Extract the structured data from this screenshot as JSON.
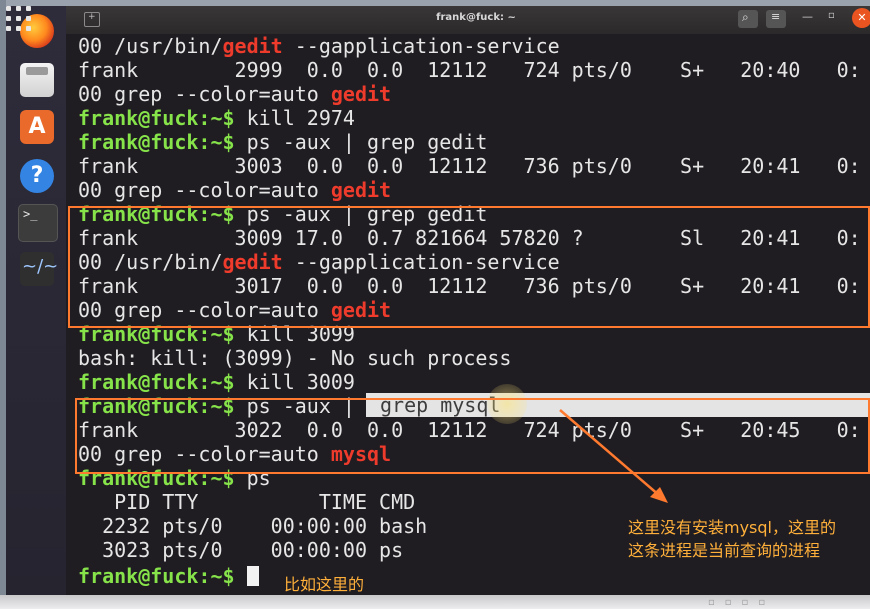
{
  "window": {
    "title": "frank@fuck: ~"
  },
  "dock": {
    "software_glyph": "A",
    "help_glyph": "?",
    "terminal_glyph": ">_",
    "sysmon_glyph": "~/~"
  },
  "titlebar_controls": {
    "search_glyph": "⌕",
    "menu_glyph": "≡",
    "minimize_glyph": "—",
    "maximize_glyph": "▫",
    "close_glyph": "✕"
  },
  "terminal": {
    "lines": {
      "l1_a": "00 /usr/bin/",
      "l1_hl": "gedit",
      "l1_b": " --gapplication-service",
      "l2": "frank        2999  0.0  0.0  12112   724 pts/0    S+   20:40   0:",
      "l3_a": "00 grep --color=auto ",
      "l3_hl": "gedit",
      "l4_prompt": "frank@fuck:~$",
      "l4_cmd": " kill 2974",
      "l5_prompt": "frank@fuck:~$",
      "l5_cmd": " ps -aux | grep gedit",
      "l6": "frank        3003  0.0  0.0  12112   736 pts/0    S+   20:41   0:",
      "l7_a": "00 grep --color=auto ",
      "l7_hl": "gedit",
      "l8_prompt": "frank@fuck:~$",
      "l8_cmd": " ps -aux | grep gedit",
      "l9": "frank        3009 17.0  0.7 821664 57820 ?        Sl   20:41   0:",
      "l10_a": "00 /usr/bin/",
      "l10_hl": "gedit",
      "l10_b": " --gapplication-service",
      "l11": "frank        3017  0.0  0.0  12112   736 pts/0    S+   20:41   0:",
      "l12_a": "00 grep --color=auto ",
      "l12_hl": "gedit",
      "l13_prompt": "frank@fuck:~$",
      "l13_cmd": " kill 3099",
      "l14": "bash: kill: (3099) - No such process",
      "l15_prompt": "frank@fuck:~$",
      "l15_cmd": " kill 3009",
      "l16_prompt": "frank@fuck:~$",
      "l16_cmd": " ps -aux |",
      "l16_highlight": "grep mysql",
      "l17": "frank        3022  0.0  0.0  12112   724 pts/0    S+   20:45   0:",
      "l18_a": "00 grep --color=auto ",
      "l18_hl": "mysql",
      "l19_prompt": "frank@fuck:~$",
      "l19_cmd": " ps",
      "l20": "   PID TTY          TIME CMD",
      "l21": "  2232 pts/0    00:00:00 bash",
      "l22": "  3023 pts/0    00:00:00 ps",
      "l23_prompt": "frank@fuck:~$",
      "l23_cmd": " "
    }
  },
  "annotations": {
    "note_right_1": "这里没有安装mysql，这里的",
    "note_right_2": "这条进程是当前查询的进程",
    "note_bottom": "比如这里的",
    "color": "#ff7a2e"
  },
  "colors": {
    "prompt": "#86e34a",
    "match_highlight": "#ef3b2c",
    "terminal_bg": "#201d22",
    "annotation_text": "#ffb03a"
  }
}
